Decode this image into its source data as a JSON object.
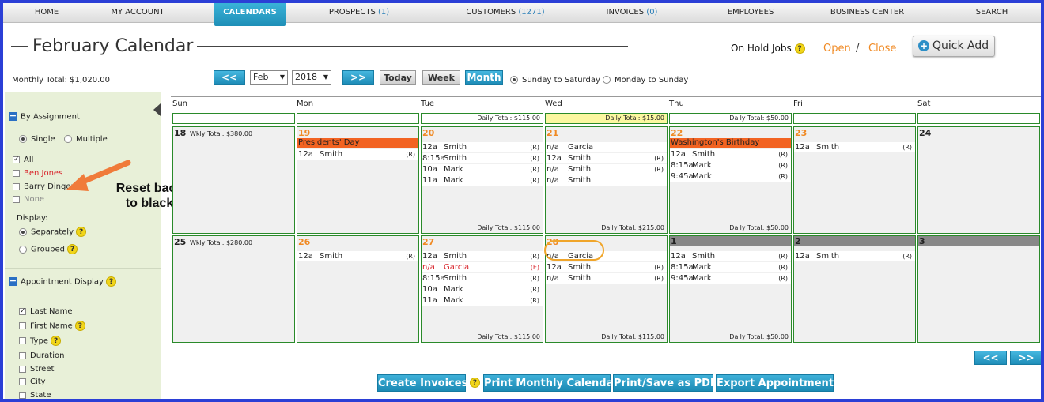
{
  "nav": {
    "items": [
      {
        "label": "HOME",
        "count": ""
      },
      {
        "label": "MY ACCOUNT",
        "count": ""
      },
      {
        "label": "CALENDARS",
        "count": ""
      },
      {
        "label": "PROSPECTS",
        "count": "(1)"
      },
      {
        "label": "CUSTOMERS",
        "count": "(1271)"
      },
      {
        "label": "INVOICES",
        "count": "(0)"
      },
      {
        "label": "EMPLOYEES",
        "count": ""
      },
      {
        "label": "BUSINESS CENTER",
        "count": ""
      },
      {
        "label": "SEARCH",
        "count": ""
      }
    ],
    "active": "CALENDARS"
  },
  "header": {
    "title": "February Calendar",
    "monthly_total": "Monthly Total: $1,020.00",
    "on_hold_label": "On Hold Jobs",
    "open_label": "Open",
    "slash": "/",
    "close_label": "Close",
    "quick_add_label": "Quick Add"
  },
  "controls": {
    "prev_label": "<<",
    "next_label": ">>",
    "month_value": "Feb",
    "year_value": "2018",
    "today_label": "Today",
    "week_label": "Week",
    "month_label": "Month",
    "week_start_options": [
      {
        "label": "Sunday to Saturday",
        "selected": true
      },
      {
        "label": "Monday to Sunday",
        "selected": false
      }
    ]
  },
  "sidebar": {
    "assignment_heading": "By Assignment",
    "single_label": "Single",
    "multiple_label": "Multiple",
    "assignees": [
      {
        "label": "All",
        "checked": true,
        "style": "normal"
      },
      {
        "label": "Ben Jones",
        "checked": false,
        "style": "red"
      },
      {
        "label": "Barry Dinger",
        "checked": false,
        "style": "normal"
      },
      {
        "label": "None",
        "checked": false,
        "style": "gray"
      }
    ],
    "display_label": "Display:",
    "separately_label": "Separately",
    "grouped_label": "Grouped",
    "appt_display_heading": "Appointment Display",
    "appt_fields": [
      {
        "label": "Last Name",
        "checked": true,
        "help": false
      },
      {
        "label": "First Name",
        "checked": false,
        "help": true
      },
      {
        "label": "Type",
        "checked": false,
        "help": true
      },
      {
        "label": "Duration",
        "checked": false,
        "help": false
      },
      {
        "label": "Street",
        "checked": false,
        "help": false
      },
      {
        "label": "City",
        "checked": false,
        "help": false
      },
      {
        "label": "State",
        "checked": false,
        "help": false
      }
    ]
  },
  "annotation": {
    "text_line1": "Reset back",
    "text_line2": "to black",
    "color": "#f07b3a"
  },
  "calendar": {
    "day_names": [
      "Sun",
      "Mon",
      "Tue",
      "Wed",
      "Thu",
      "Fri",
      "Sat"
    ],
    "top_daily_totals": [
      "",
      "",
      "Daily Total: $115.00",
      "Daily Total: $15.00",
      "Daily Total: $50.00",
      "",
      ""
    ],
    "weeks": [
      {
        "days": [
          {
            "num": "18",
            "weekly_total": "Wkly Total: $380.00",
            "holiday": "",
            "appts": [],
            "daily_total": ""
          },
          {
            "num": "19",
            "holiday": "Presidents' Day",
            "appts": [
              {
                "time": "12a",
                "name": "Smith",
                "tag": "(R)"
              }
            ],
            "daily_total": ""
          },
          {
            "num": "20",
            "holiday": "",
            "appts": [
              {
                "time": "12a",
                "name": "Smith",
                "tag": "(R)"
              },
              {
                "time": "8:15a",
                "name": "Smith",
                "tag": "(R)"
              },
              {
                "time": "10a",
                "name": "Mark",
                "tag": "(R)"
              },
              {
                "time": "11a",
                "name": "Mark",
                "tag": "(R)"
              }
            ],
            "daily_total": "Daily Total: $115.00"
          },
          {
            "num": "21",
            "holiday": "",
            "appts": [
              {
                "time": "n/a",
                "name": "Garcia",
                "tag": ""
              },
              {
                "time": "12a",
                "name": "Smith",
                "tag": "(R)"
              },
              {
                "time": "n/a",
                "name": "Smith",
                "tag": "(R)"
              },
              {
                "time": "n/a",
                "name": "Smith",
                "tag": ""
              }
            ],
            "daily_total": "Daily Total: $215.00"
          },
          {
            "num": "22",
            "holiday": "Washington's Birthday",
            "appts": [
              {
                "time": "12a",
                "name": "Smith",
                "tag": "(R)"
              },
              {
                "time": "8:15a",
                "name": "Mark",
                "tag": "(R)"
              },
              {
                "time": "9:45a",
                "name": "Mark",
                "tag": "(R)"
              }
            ],
            "daily_total": "Daily Total: $50.00"
          },
          {
            "num": "23",
            "holiday": "",
            "appts": [
              {
                "time": "12a",
                "name": "Smith",
                "tag": "(R)"
              }
            ],
            "daily_total": ""
          },
          {
            "num": "24",
            "holiday": "",
            "appts": [],
            "daily_total": ""
          }
        ]
      },
      {
        "days": [
          {
            "num": "25",
            "weekly_total": "Wkly Total: $280.00",
            "holiday": "",
            "appts": [],
            "daily_total": ""
          },
          {
            "num": "26",
            "holiday": "",
            "appts": [
              {
                "time": "12a",
                "name": "Smith",
                "tag": "(R)"
              }
            ],
            "daily_total": ""
          },
          {
            "num": "27",
            "holiday": "",
            "appts": [
              {
                "time": "12a",
                "name": "Smith",
                "tag": "(R)"
              },
              {
                "time": "n/a",
                "name": "Garcia",
                "tag": "(E)",
                "red": true
              },
              {
                "time": "8:15a",
                "name": "Smith",
                "tag": "(R)"
              },
              {
                "time": "10a",
                "name": "Mark",
                "tag": "(R)"
              },
              {
                "time": "11a",
                "name": "Mark",
                "tag": "(R)"
              }
            ],
            "daily_total": "Daily Total: $115.00"
          },
          {
            "num": "28",
            "holiday": "",
            "appts": [
              {
                "time": "n/a",
                "name": "Garcia",
                "tag": ""
              },
              {
                "time": "12a",
                "name": "Smith",
                "tag": "(R)"
              },
              {
                "time": "n/a",
                "name": "Smith",
                "tag": "(R)"
              }
            ],
            "daily_total": "Daily Total: $115.00"
          },
          {
            "num": "1",
            "other_month": true,
            "holiday": "",
            "appts": [
              {
                "time": "12a",
                "name": "Smith",
                "tag": "(R)"
              },
              {
                "time": "8:15a",
                "name": "Mark",
                "tag": "(R)"
              },
              {
                "time": "9:45a",
                "name": "Mark",
                "tag": "(R)"
              }
            ],
            "daily_total": "Daily Total: $50.00"
          },
          {
            "num": "2",
            "other_month": true,
            "holiday": "",
            "appts": [
              {
                "time": "12a",
                "name": "Smith",
                "tag": "(R)"
              }
            ],
            "daily_total": ""
          },
          {
            "num": "3",
            "other_month": true,
            "holiday": "",
            "appts": [],
            "daily_total": ""
          }
        ]
      }
    ]
  },
  "bottom": {
    "prev_label": "<<",
    "next_label": ">>",
    "create_invoices": "Create Invoices",
    "print_monthly": "Print Monthly Calendar",
    "print_pdf": "Print/Save as PDF",
    "export": "Export Appointments"
  },
  "colors": {
    "frame": "#2b3fd6",
    "accent_blue": "#1f8fb7",
    "holiday_orange": "#f26322",
    "today_yellow": "#fbf7a0",
    "cell_border": "#2a8a2a"
  }
}
